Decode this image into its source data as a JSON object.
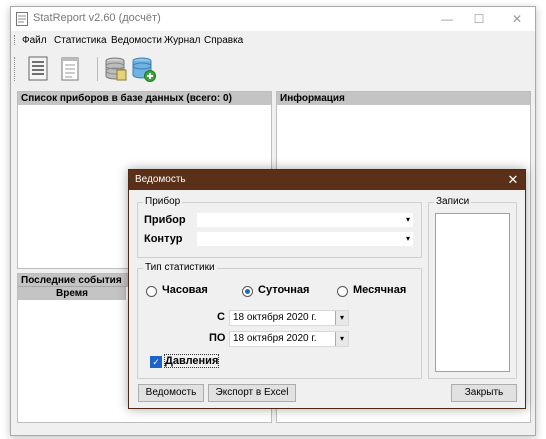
{
  "window": {
    "title": "StatReport v2.60 (досчёт)",
    "minimize": "—",
    "maximize": "☐",
    "close": "✕"
  },
  "menu": [
    "Файл",
    "Статистика",
    "Ведомости",
    "Журнал",
    "Справка"
  ],
  "toolbar": {
    "buttons": [
      {
        "icon": "document-list-icon"
      },
      {
        "icon": "notepad-icon"
      },
      {
        "icon": "database-icon"
      },
      {
        "icon": "database-add-icon"
      }
    ]
  },
  "devices_panel": {
    "title": "Список приборов в базе данных (всего: 0)"
  },
  "info_panel": {
    "title": "Информация"
  },
  "events_panel": {
    "title": "Последние события",
    "col_time": "Время"
  },
  "dialog": {
    "title": "Ведомость",
    "close": "✕",
    "device_group": {
      "label": "Прибор",
      "device_label": "Прибор",
      "device_value": "",
      "contour_label": "Контур",
      "contour_value": ""
    },
    "records_group": {
      "label": "Записи"
    },
    "stat_group": {
      "label": "Тип статистики",
      "options": [
        {
          "label": "Часовая",
          "selected": false
        },
        {
          "label": "Суточная",
          "selected": true
        },
        {
          "label": "Месячная",
          "selected": false
        }
      ],
      "from_label": "С",
      "from_date": "18  октября  2020 г.",
      "to_label": "ПО",
      "to_date": "18  октября  2020 г.",
      "pressure_label": "Давления",
      "pressure_checked": true
    },
    "buttons": {
      "statement": "Ведомость",
      "export": "Экспорт в Excel",
      "close": "Закрыть"
    }
  },
  "colors": {
    "dialog_title_bg": "#5b3018",
    "panel_header_bg": "#c4c4c4",
    "accent": "#1e64c8"
  }
}
